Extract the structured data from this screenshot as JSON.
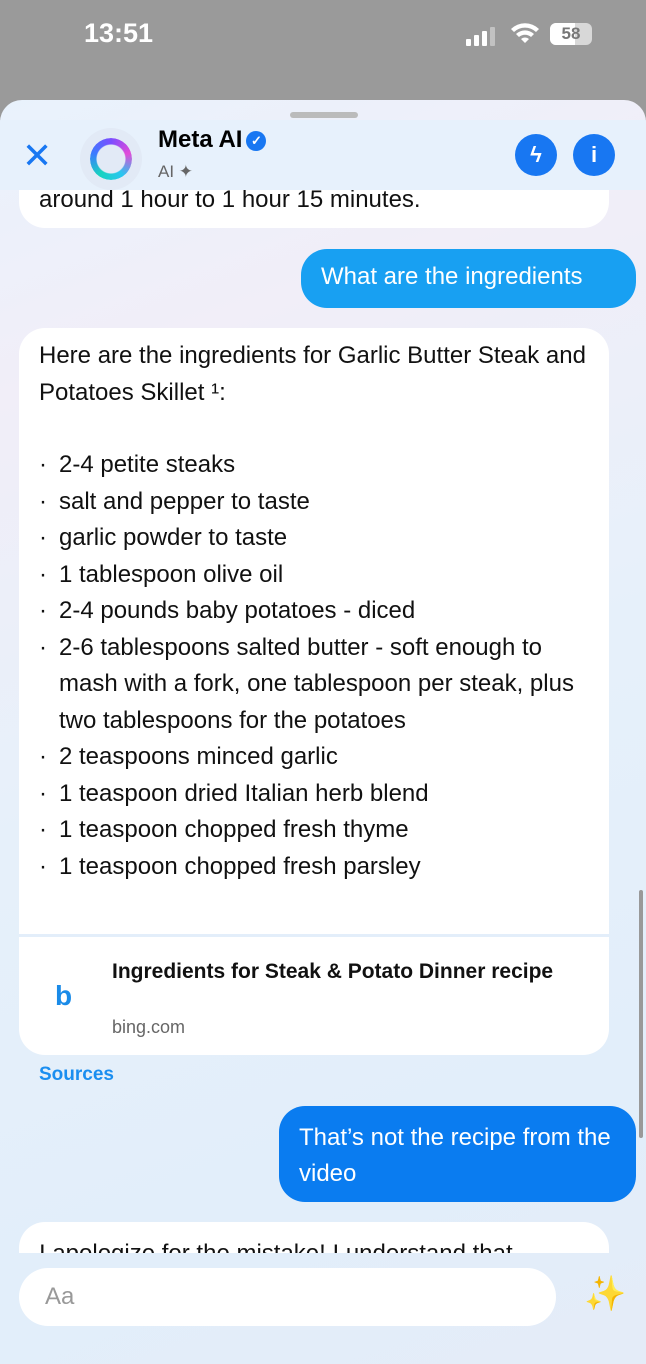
{
  "status": {
    "time": "13:51",
    "battery": "58"
  },
  "header": {
    "title": "Meta AI",
    "subtitle": "AI",
    "close_icon": "close-icon",
    "messenger_icon": "messenger-icon",
    "info_icon": "info-icon"
  },
  "messages": {
    "ai1_tail": "around 1 hour to 1 hour 15 minutes.",
    "user1": "What are the ingredients",
    "ai2": {
      "intro": "Here are the ingredients for Garlic Butter Steak and Potatoes Skillet ¹:",
      "items": [
        "2-4 petite steaks",
        "salt and pepper to taste",
        "garlic powder to taste",
        "1 tablespoon olive oil",
        "2-4 pounds baby potatoes - diced",
        "2-6 tablespoons salted butter - soft enough to mash with a fork, one tablespoon per steak, plus two tablespoons for the potatoes",
        "2 teaspoons minced garlic",
        "1 teaspoon dried Italian herb blend",
        "1 teaspoon chopped fresh thyme",
        "1 teaspoon chopped fresh parsley"
      ],
      "source": {
        "title": "Ingredients for Steak & Potato Dinner recipe",
        "domain": "bing.com"
      }
    },
    "sources_label": "Sources",
    "user2": "That’s not the recipe from the video",
    "ai3_partial": "I apologize for the mistake! I understand that"
  },
  "composer": {
    "placeholder": "Aa"
  },
  "colors": {
    "accent": "#1877f2",
    "user_bubble_1": "#18a0f2",
    "user_bubble_2": "#0a7cf0"
  }
}
